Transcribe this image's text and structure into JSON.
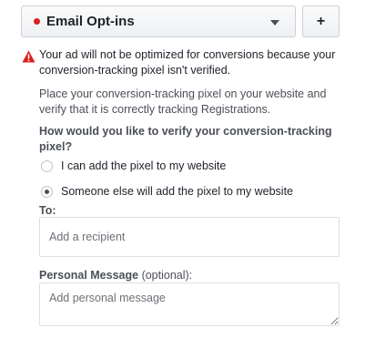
{
  "event_select": {
    "selected_label": "Email Opt-ins",
    "status_color": "#dd1e1e",
    "icon": "chevron-down-icon"
  },
  "add_button": {
    "label": "+"
  },
  "warning": {
    "icon": "warning-icon",
    "color": "#dd1e1e",
    "text": "Your ad will not be optimized for conversions because your conversion-tracking pixel isn't verified."
  },
  "info": {
    "text": "Place your conversion-tracking pixel on your website and verify that it is correctly tracking Registrations."
  },
  "verify": {
    "question": "How would you like to verify your conversion-tracking pixel?",
    "options": [
      {
        "label": "I can add the pixel to my website",
        "selected": false
      },
      {
        "label": "Someone else will add the pixel to my website",
        "selected": true
      }
    ]
  },
  "recipient": {
    "label": "To:",
    "placeholder": "Add a recipient"
  },
  "personal_message": {
    "label": "Personal Message",
    "optional": " (optional):",
    "placeholder": "Add personal message"
  }
}
